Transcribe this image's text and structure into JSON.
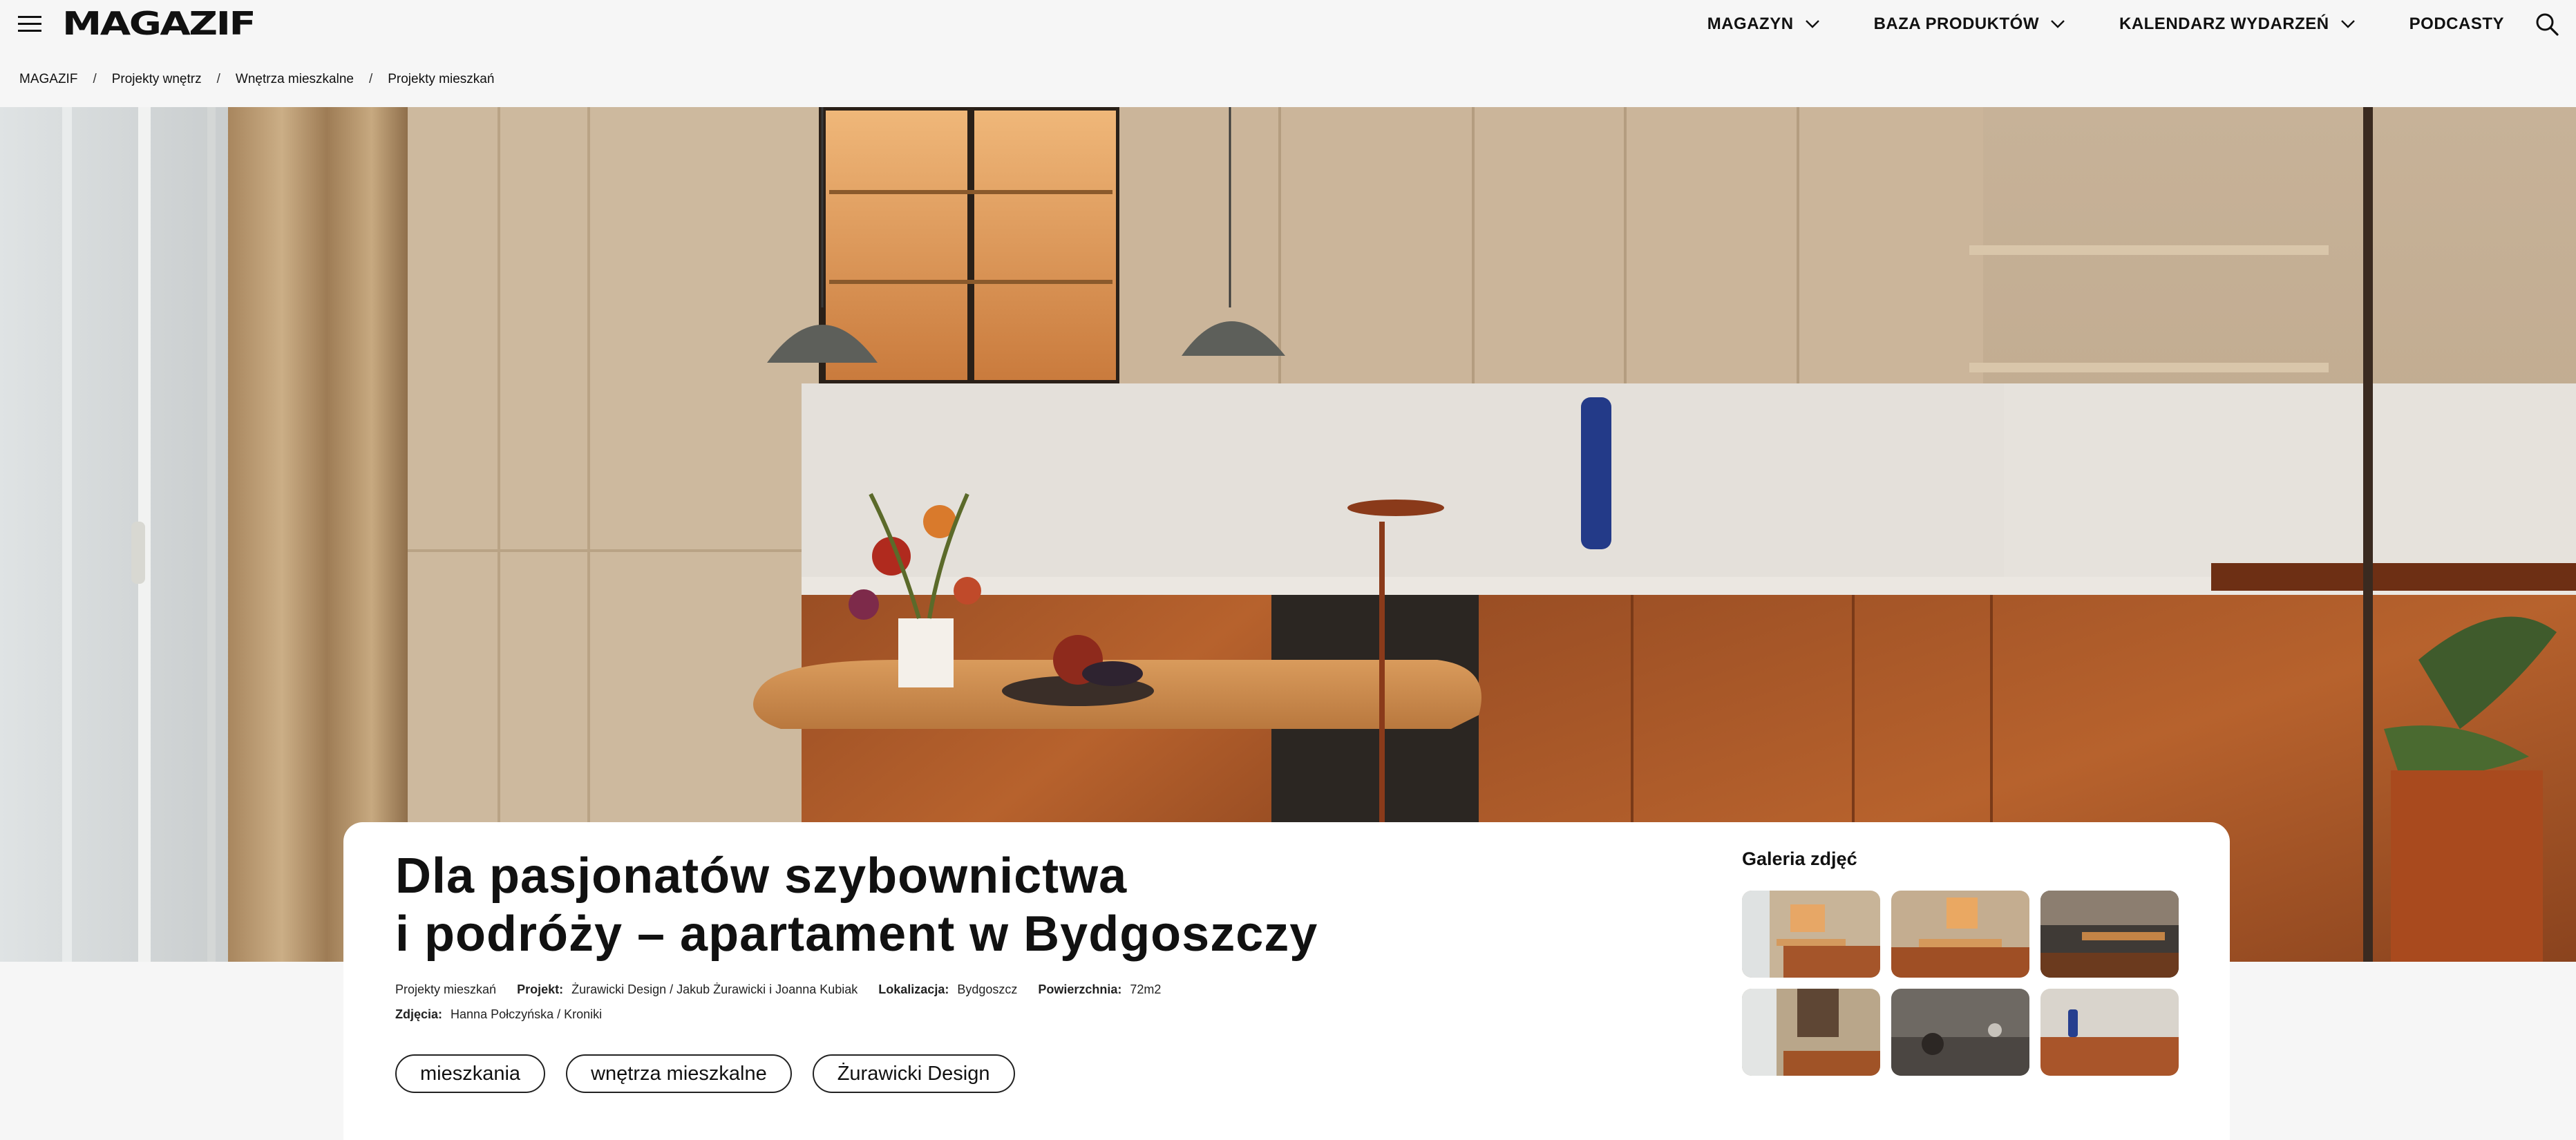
{
  "header": {
    "logo": "MAGAZIF",
    "nav": [
      {
        "label": "MAGAZYN"
      },
      {
        "label": "BAZA PRODUKTÓW"
      },
      {
        "label": "KALENDARZ WYDARZEŃ"
      },
      {
        "label": "PODCASTY"
      }
    ]
  },
  "breadcrumb": [
    "MAGAZIF",
    "Projekty wnętrz",
    "Wnętrza mieszkalne",
    "Projekty mieszkań"
  ],
  "breadcrumb_separator": "/",
  "article": {
    "title_line1": "Dla pasjonatów szybownictwa",
    "title_line2": "i podróży – apartament w Bydgoszczy",
    "category": "Projekty mieszkań",
    "meta": {
      "project_label": "Projekt:",
      "project_value": "Żurawicki Design / Jakub Żurawicki i Joanna Kubiak",
      "location_label": "Lokalizacja:",
      "location_value": "Bydgoszcz",
      "area_label": "Powierzchnia:",
      "area_value": "72m2",
      "photos_label": "Zdjęcia:",
      "photos_value": "Hanna Połczyńska / Kroniki"
    },
    "tags": [
      "mieszkania",
      "wnętrza mieszkalne",
      "Żurawicki Design"
    ]
  },
  "gallery": {
    "title": "Galeria zdjęć",
    "thumb_count": 6
  },
  "icons": {
    "menu": "hamburger-icon",
    "search": "search-icon",
    "dropdown": "chevron-down-icon"
  },
  "colors": {
    "background": "#f6f6f6",
    "card": "#ffffff",
    "text": "#111111"
  }
}
